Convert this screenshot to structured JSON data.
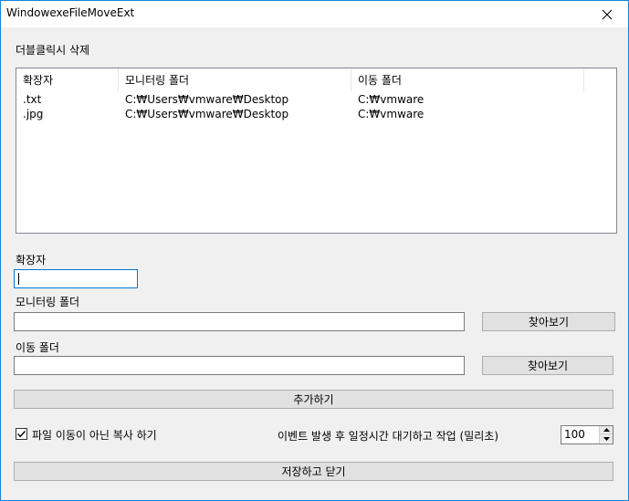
{
  "window": {
    "title": "WindowexeFileMoveExt"
  },
  "hint_label": "더블클릭시 삭제",
  "list": {
    "columns": [
      "확장자",
      "모니터링 폴더",
      "이동 폴더"
    ],
    "rows": [
      {
        "ext": ".txt",
        "monitor": "C:₩Users₩vmware₩Desktop",
        "dest": "C:₩vmware"
      },
      {
        "ext": ".jpg",
        "monitor": "C:₩Users₩vmware₩Desktop",
        "dest": "C:₩vmware"
      }
    ]
  },
  "form": {
    "ext_label": "확장자",
    "ext_value": "",
    "monitor_label": "모니터링 폴더",
    "monitor_value": "",
    "monitor_browse": "찾아보기",
    "dest_label": "이동 폴더",
    "dest_value": "",
    "dest_browse": "찾아보기",
    "add_button": "추가하기"
  },
  "options": {
    "copy_checkbox_label": "파일 이동이 아닌 복사 하기",
    "copy_checked": true,
    "delay_label": "이벤트 발생 후 일정시간 대기하고 작업 (밀리초)",
    "delay_value": "100"
  },
  "save_button": "저장하고 닫기"
}
